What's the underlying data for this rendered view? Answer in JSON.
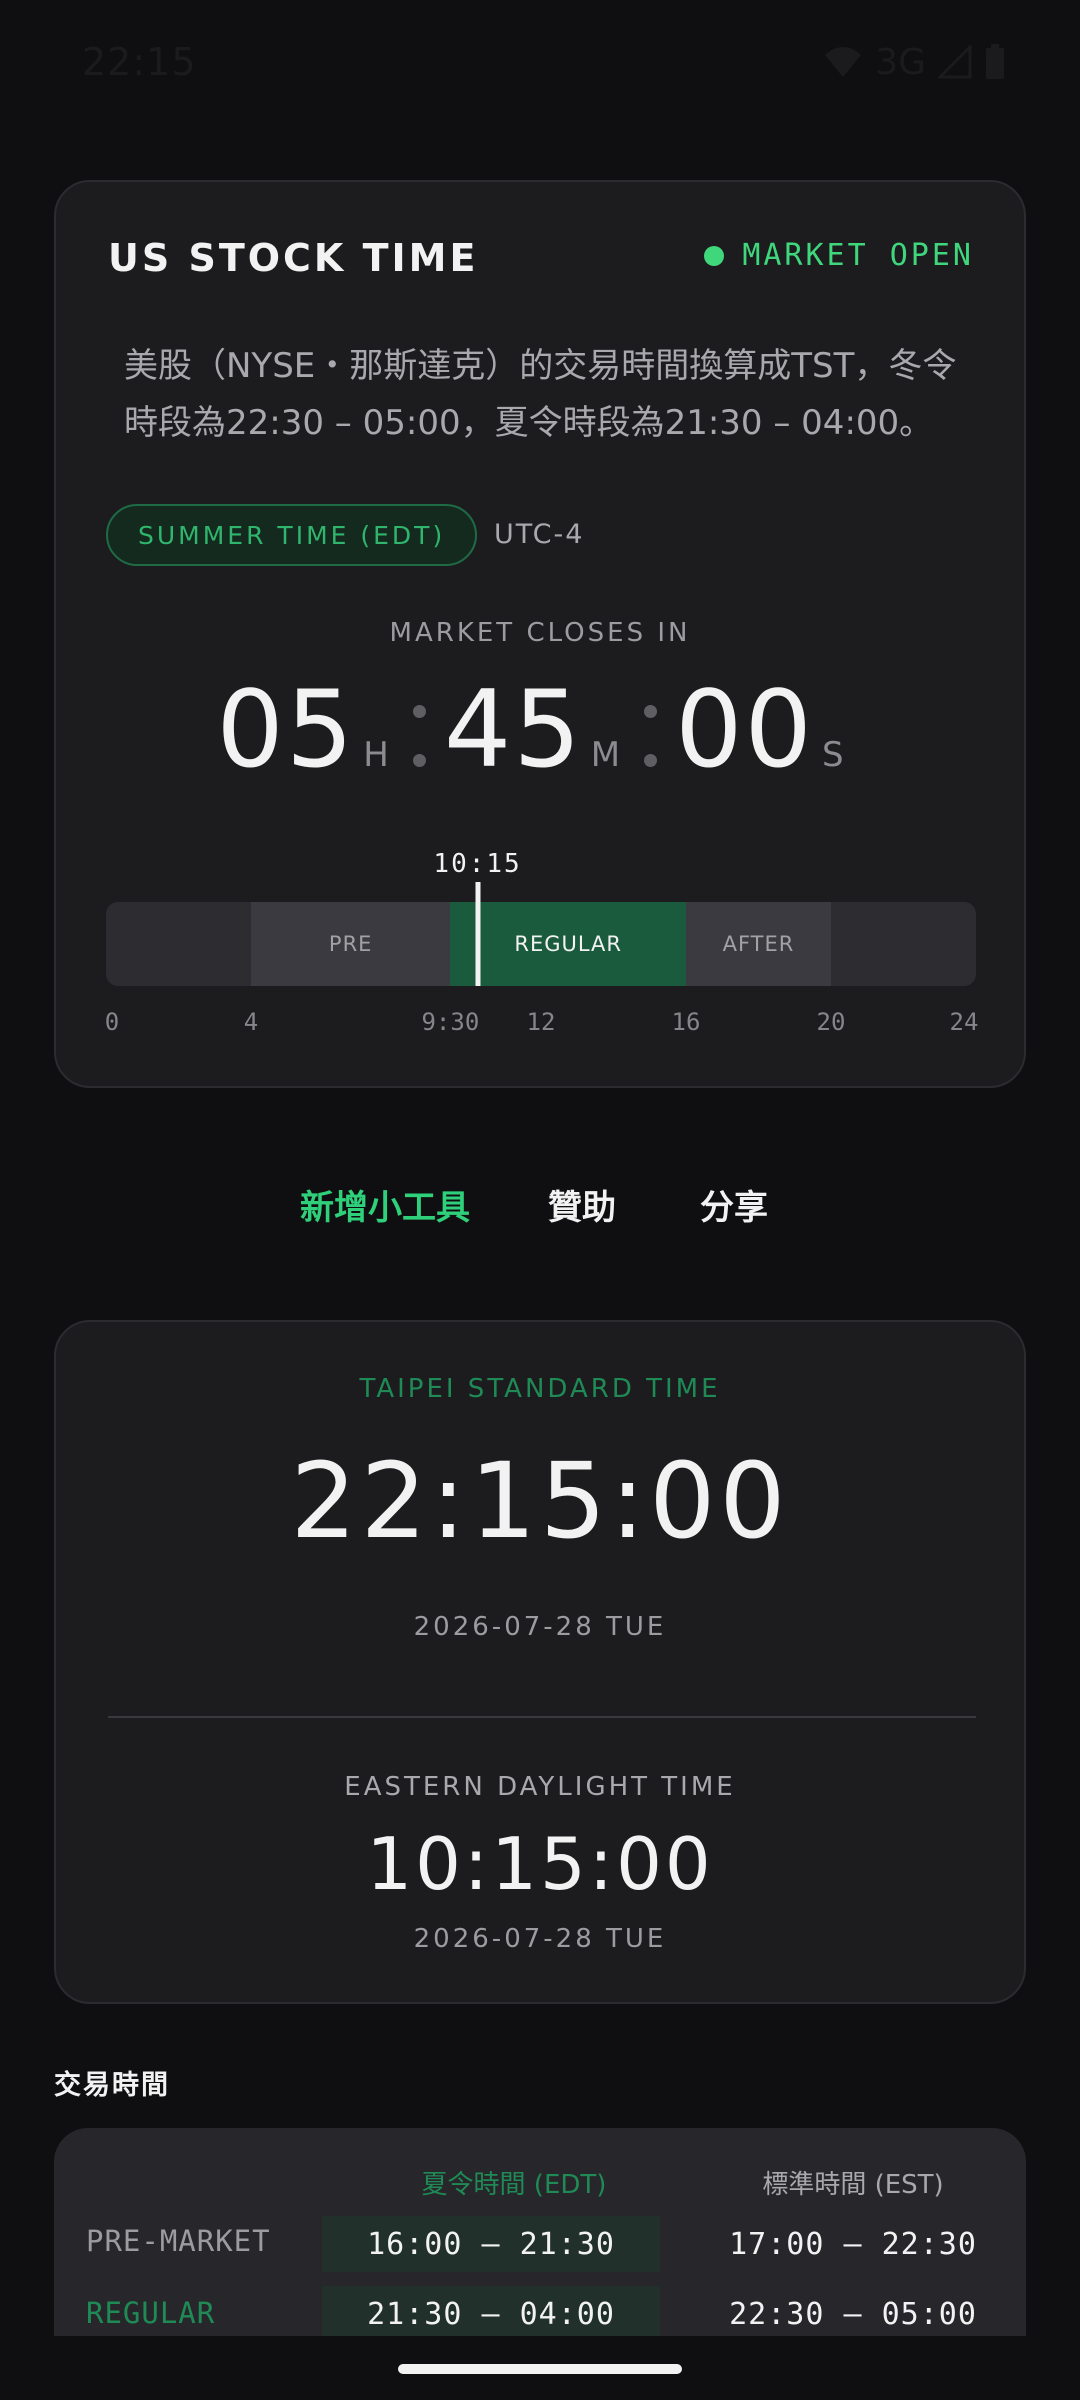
{
  "status_bar": {
    "time": "22:15",
    "network": "3G",
    "icons": [
      "wifi-icon",
      "signal-icon",
      "battery-icon"
    ]
  },
  "us_card": {
    "title": "US STOCK TIME",
    "market_status": "MARKET OPEN",
    "description": "美股（NYSE・那斯達克）的交易時間換算成TST，冬令時段為22:30 – 05:00，夏令時段為21:30 – 04:00。",
    "season_badge": "SUMMER TIME (EDT)",
    "utc_offset": "UTC-4",
    "countdown_label": "MARKET CLOSES IN",
    "countdown": {
      "hours": "05",
      "hours_unit": "H",
      "minutes": "45",
      "minutes_unit": "M",
      "seconds": "00",
      "seconds_unit": "S"
    },
    "timeline": {
      "now_label": "10:15",
      "now_hour": 10.25,
      "segments": [
        {
          "label": "PRE",
          "start": 4,
          "end": 9.5
        },
        {
          "label": "REGULAR",
          "start": 9.5,
          "end": 16
        },
        {
          "label": "AFTER",
          "start": 16,
          "end": 20
        }
      ],
      "ticks": [
        {
          "label": "0",
          "hour": 0
        },
        {
          "label": "4",
          "hour": 4
        },
        {
          "label": "9:30",
          "hour": 9.5
        },
        {
          "label": "12",
          "hour": 12
        },
        {
          "label": "16",
          "hour": 16
        },
        {
          "label": "20",
          "hour": 20
        },
        {
          "label": "24",
          "hour": 24
        }
      ]
    }
  },
  "tabs": [
    {
      "label": "新增小工具",
      "active": true
    },
    {
      "label": "贊助",
      "active": false
    },
    {
      "label": "分享",
      "active": false
    }
  ],
  "clock_card": {
    "taipei_label": "TAIPEI STANDARD TIME",
    "taipei_time": "22:15:00",
    "taipei_date": "2026-07-28 TUE",
    "eastern_label": "EASTERN DAYLIGHT TIME",
    "eastern_time": "10:15:00",
    "eastern_date": "2026-07-28 TUE"
  },
  "trading_hours": {
    "title": "交易時間",
    "header_edt": "夏令時間 (EDT)",
    "header_est": "標準時間 (EST)",
    "rows": [
      {
        "label": "PRE-MARKET",
        "edt": "16:00 – 21:30",
        "est": "17:00 – 22:30"
      },
      {
        "label": "REGULAR",
        "edt": "21:30 – 04:00",
        "est": "22:30 – 05:00"
      }
    ]
  },
  "colors": {
    "accent_green": "#3fd67c",
    "regular_segment": "#1b5b3d",
    "card_bg": "#1c1c1f",
    "page_bg": "#0f0f11"
  }
}
